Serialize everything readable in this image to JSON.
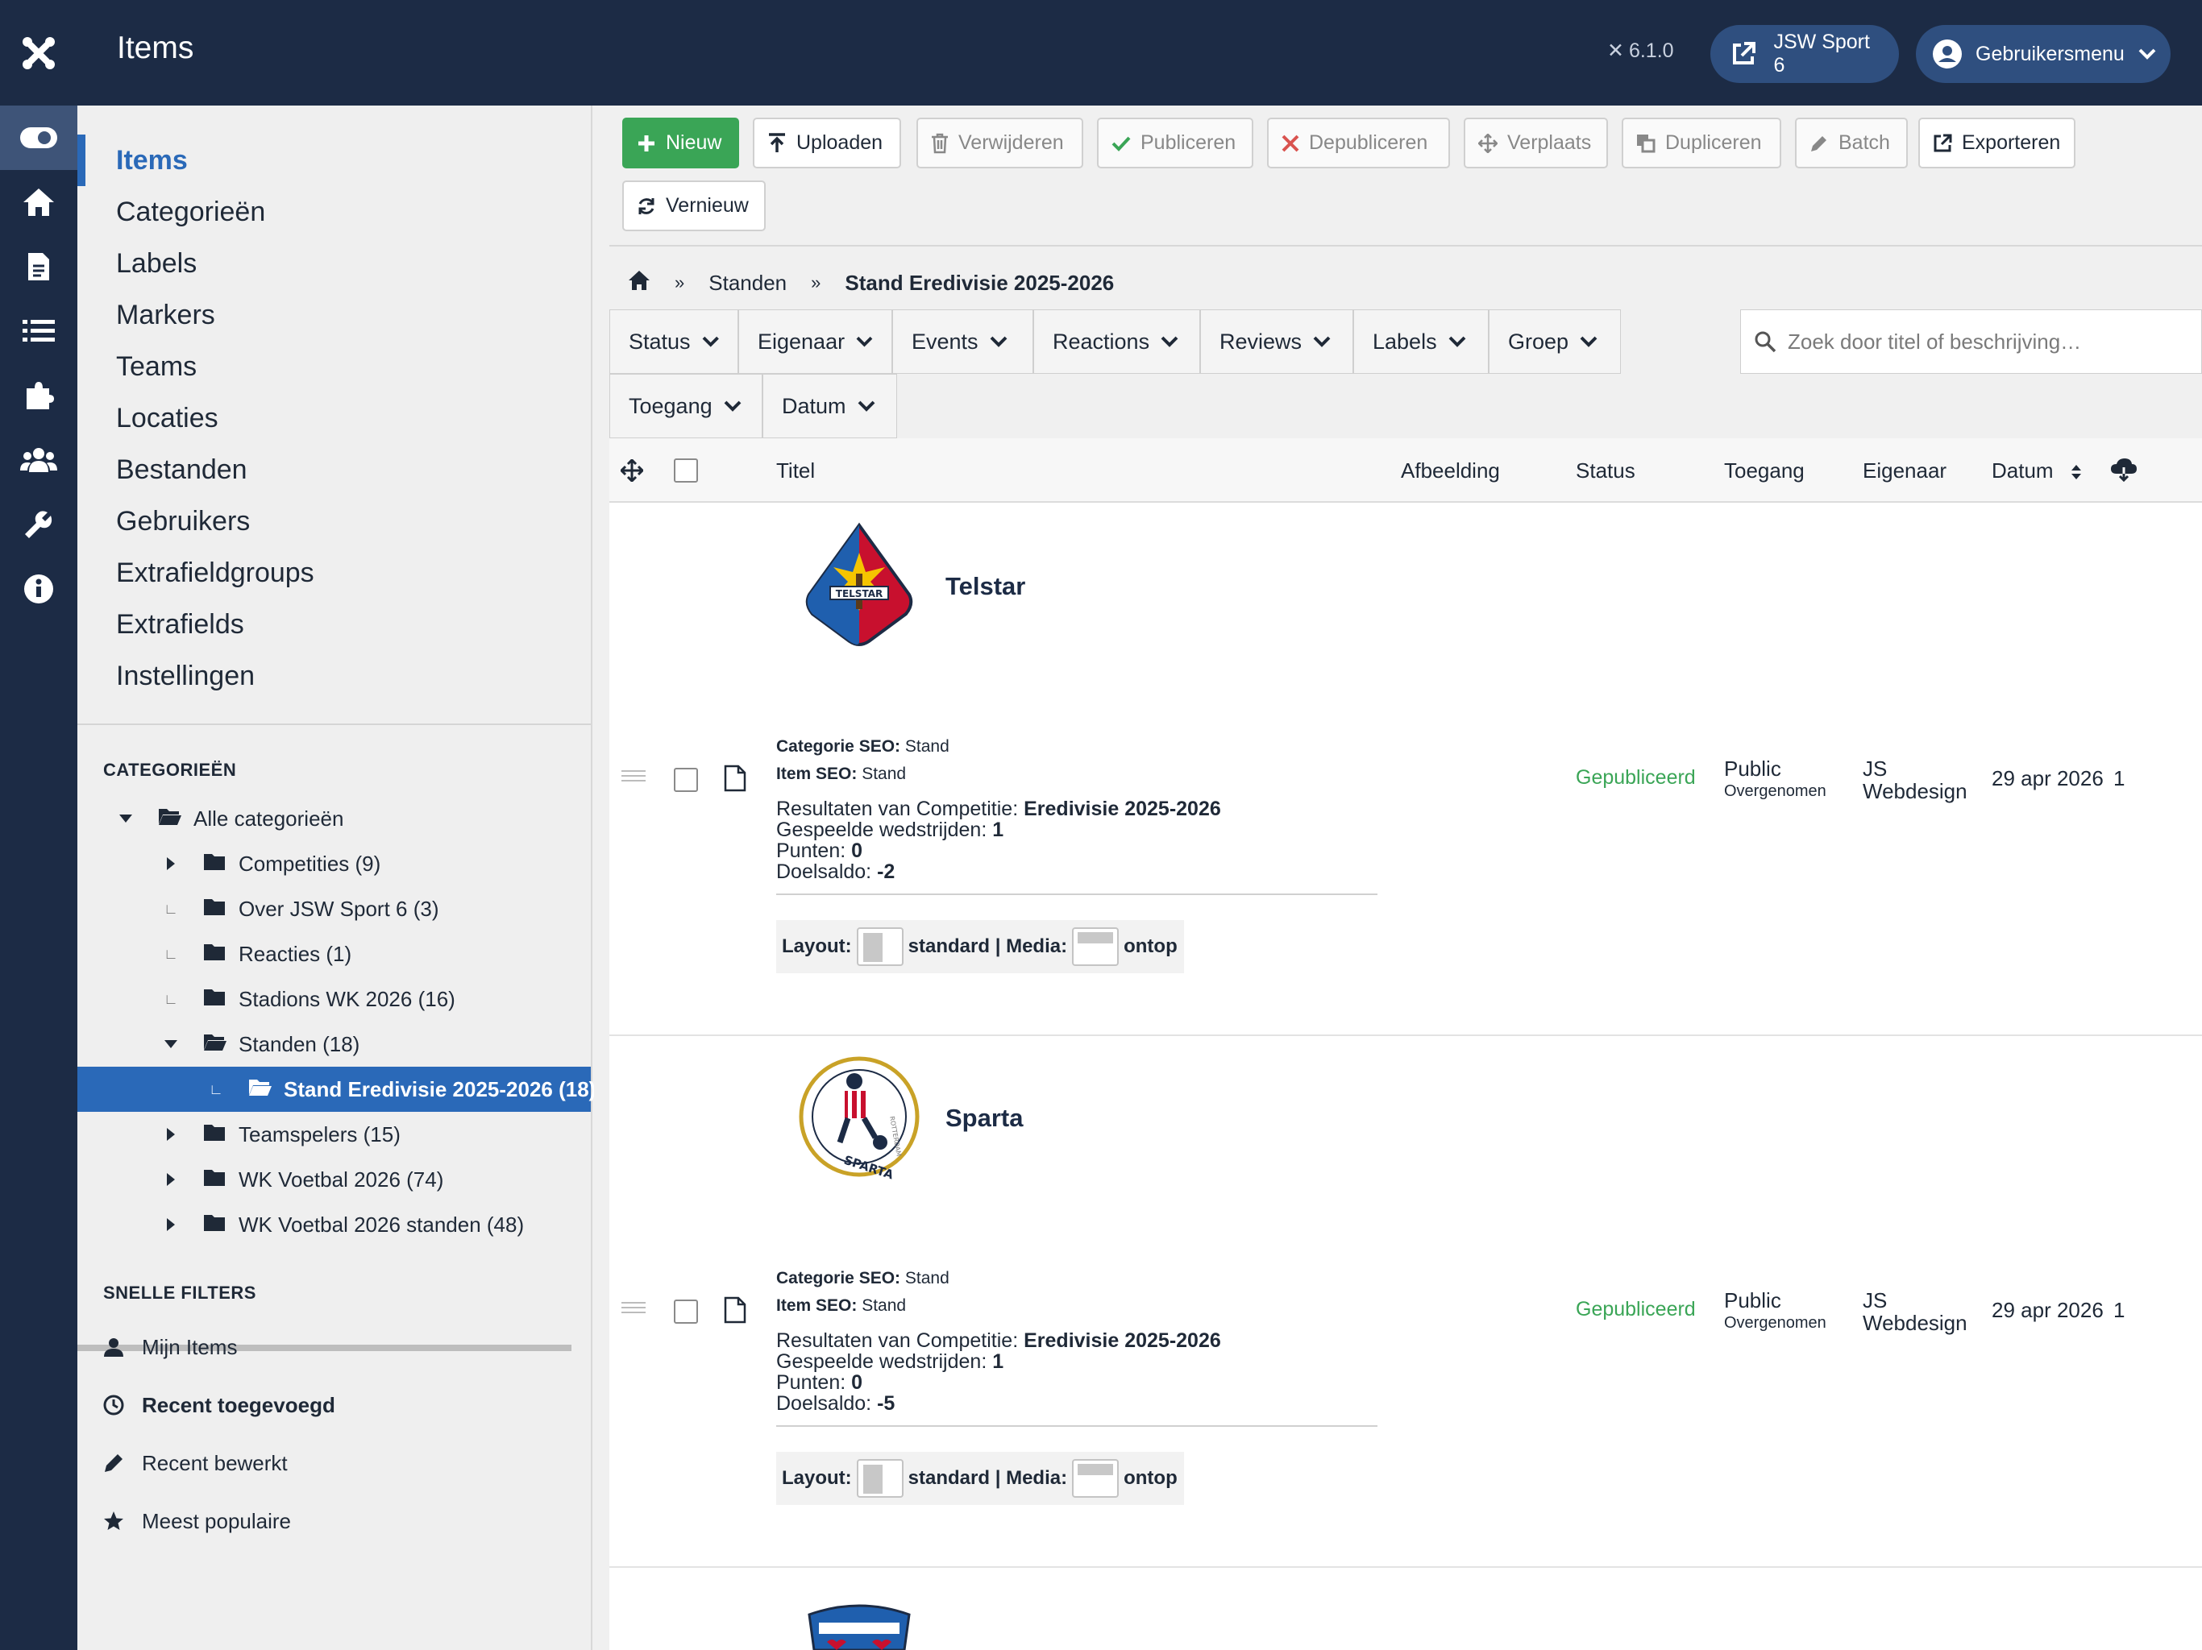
{
  "header": {
    "title": "Items",
    "version": "6.1.0",
    "site_button": "JSW Sport 6",
    "user_menu": "Gebruikersmenu"
  },
  "rail": [
    "toggle-icon",
    "home-icon",
    "file-icon",
    "list-icon",
    "puzzle-icon",
    "users-icon",
    "wrench-icon",
    "info-icon"
  ],
  "submenu": {
    "items": [
      "Items",
      "Categorieën",
      "Labels",
      "Markers",
      "Teams",
      "Locaties",
      "Bestanden",
      "Gebruikers",
      "Extrafieldgroups",
      "Extrafields",
      "Instellingen"
    ],
    "categories_title": "CATEGORIEËN",
    "tree": [
      {
        "label": "Alle categorieën"
      },
      {
        "label": "Competities (9)"
      },
      {
        "label": "Over JSW Sport 6 (3)"
      },
      {
        "label": "Reacties (1)"
      },
      {
        "label": "Stadions WK 2026 (16)"
      },
      {
        "label": "Standen (18)"
      },
      {
        "label": "Stand Eredivisie 2025-2026 (18)"
      },
      {
        "label": "Teamspelers (15)"
      },
      {
        "label": "WK Voetbal 2026 (74)"
      },
      {
        "label": "WK Voetbal 2026 standen (48)"
      }
    ],
    "quick_filters_title": "SNELLE FILTERS",
    "quick_filters": [
      "Mijn Items",
      "Recent toegevoegd",
      "Recent bewerkt",
      "Meest populaire"
    ]
  },
  "toolbar": {
    "new": "Nieuw",
    "upload": "Uploaden",
    "delete": "Verwijderen",
    "publish": "Publiceren",
    "unpublish": "Depubliceren",
    "move": "Verplaats",
    "duplicate": "Dupliceren",
    "batch": "Batch",
    "export": "Exporteren",
    "refresh": "Vernieuw"
  },
  "breadcrumb": {
    "sep": "»",
    "level1": "Standen",
    "current": "Stand Eredivisie 2025-2026"
  },
  "filters": [
    "Status",
    "Eigenaar",
    "Events",
    "Reactions",
    "Reviews",
    "Labels",
    "Groep",
    "Toegang",
    "Datum"
  ],
  "search": {
    "placeholder": "Zoek door titel of beschrijving…"
  },
  "table": {
    "headers": {
      "title": "Titel",
      "image": "Afbeelding",
      "status": "Status",
      "access": "Toegang",
      "owner": "Eigenaar",
      "date": "Datum"
    },
    "rows": [
      {
        "name": "Telstar",
        "cat_seo_label": "Categorie SEO:",
        "cat_seo": "Stand",
        "item_seo_label": "Item SEO:",
        "item_seo": "Stand",
        "comp_label": "Resultaten van Competitie:",
        "comp": "Eredivisie 2025-2026",
        "played_label": "Gespeelde wedstrijden:",
        "played": "1",
        "points_label": "Punten:",
        "points": "0",
        "gd_label": "Doelsaldo:",
        "gd": "-2",
        "layout_label": "Layout:",
        "layout_value": "standard | Media:",
        "media_value": "ontop",
        "status": "Gepubliceerd",
        "access": "Public",
        "access_sub": "Overgenomen",
        "owner1": "JS",
        "owner2": "Webdesign",
        "date": "29 apr 2026",
        "hits": "1"
      },
      {
        "name": "Sparta",
        "cat_seo_label": "Categorie SEO:",
        "cat_seo": "Stand",
        "item_seo_label": "Item SEO:",
        "item_seo": "Stand",
        "comp_label": "Resultaten van Competitie:",
        "comp": "Eredivisie 2025-2026",
        "played_label": "Gespeelde wedstrijden:",
        "played": "1",
        "points_label": "Punten:",
        "points": "0",
        "gd_label": "Doelsaldo:",
        "gd": "-5",
        "layout_label": "Layout:",
        "layout_value": "standard | Media:",
        "media_value": "ontop",
        "status": "Gepubliceerd",
        "access": "Public",
        "access_sub": "Overgenomen",
        "owner1": "JS",
        "owner2": "Webdesign",
        "date": "29 apr 2026",
        "hits": "1"
      }
    ]
  },
  "logo_text": {
    "telstar": "TELSTAR",
    "sparta": "SPARTA",
    "sparta_small": "ROTTERDAM"
  },
  "colors": {
    "header": "#1c2b45",
    "accent": "#2a69b8",
    "green": "#3aa556",
    "published": "#3aa556"
  }
}
